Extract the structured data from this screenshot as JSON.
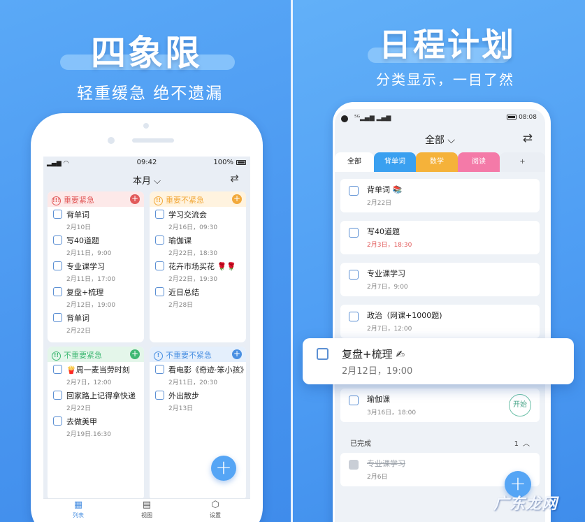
{
  "left": {
    "title": "四象限",
    "subtitle": "轻重缓急 绝不遗漏",
    "status": {
      "time": "09:42",
      "battery": "100%"
    },
    "header": {
      "title": "本月",
      "chevron": "⌵",
      "swap_icon": "⇄"
    },
    "quadrants": [
      {
        "title": "重要紧急",
        "icon": "!!!",
        "color": "#e25a5a",
        "bg": "#fde9e9",
        "tasks": [
          {
            "title": "背单词",
            "date": "2月10日"
          },
          {
            "title": "写40道题",
            "date": "2月11日，9:00"
          },
          {
            "title": "专业课学习",
            "date": "2月11日，17:00"
          },
          {
            "title": "复盘+梳理",
            "date": "2月12日，19:00"
          },
          {
            "title": "背单词",
            "date": "2月22日"
          }
        ]
      },
      {
        "title": "重要不紧急",
        "icon": "!!",
        "color": "#f2a93b",
        "bg": "#fff3df",
        "tasks": [
          {
            "title": "学习交流会",
            "date": "2月16日，09:30"
          },
          {
            "title": "瑜伽课",
            "date": "2月22日，18:30"
          },
          {
            "title": "花卉市场买花 🌹🌹",
            "date": "2月22日，19:30"
          },
          {
            "title": "近日总结",
            "date": "2月28日"
          }
        ]
      },
      {
        "title": "不重要紧急",
        "icon": "!!",
        "color": "#3fb873",
        "bg": "#e4f6ea",
        "tasks": [
          {
            "title": "🍟周一麦当劳时刻",
            "date": "2月7日，12:00"
          },
          {
            "title": "回家路上记得拿快递",
            "date": "2月22日"
          },
          {
            "title": "去做美甲",
            "date": "2月19日.16:30"
          }
        ]
      },
      {
        "title": "不重要不紧急",
        "icon": "!",
        "color": "#4a90e2",
        "bg": "#e4effc",
        "tasks": [
          {
            "title": "看电影《奇迹·笨小孩》",
            "date": "2月11日，20:30"
          },
          {
            "title": "外出散步",
            "date": "2月13日"
          }
        ]
      }
    ],
    "fab": "+",
    "nav": [
      {
        "label": "列表",
        "icon": "▦"
      },
      {
        "label": "视图",
        "icon": "▤"
      },
      {
        "label": "设置",
        "icon": "⬡"
      }
    ]
  },
  "right": {
    "title": "日程计划",
    "subtitle": "分类显示，一目了然",
    "status": {
      "time": "08:08"
    },
    "header": {
      "title": "全部",
      "chevron": "⌵",
      "swap_icon": "⇄"
    },
    "tabs": [
      {
        "label": "全部",
        "color": "#ffffff",
        "text": "#222222"
      },
      {
        "label": "背单词",
        "color": "#3aa0f0",
        "text": "#ffffff"
      },
      {
        "label": "数学",
        "color": "#f5b23a",
        "text": "#ffffff"
      },
      {
        "label": "阅读",
        "color": "#f47aa8",
        "text": "#ffffff"
      },
      {
        "label": "+",
        "color": "#eaeef4",
        "text": "#555555"
      }
    ],
    "tasks": [
      {
        "title": "背单词 📚",
        "date": "2月22日"
      },
      {
        "title": "写40道题",
        "date": "2月3日，18:30",
        "overdue": true
      },
      {
        "title": "专业课学习",
        "date": "2月7日，9:00"
      },
      {
        "title": "政治（网课+1000题)",
        "date": "2月7日，12:00"
      }
    ],
    "floating_task": {
      "title": "复盘+梳理 ✍",
      "date": "2月12日，19:00"
    },
    "yoga_task": {
      "title": "瑜伽课",
      "date": "3月16日，18:00",
      "button": "开始"
    },
    "completed": {
      "label": "已完成",
      "count": "1",
      "chevron": "︿"
    },
    "done_task": {
      "title": "专业课学习",
      "date": "2月6日"
    },
    "fab": "+"
  },
  "watermark": "广东龙网"
}
